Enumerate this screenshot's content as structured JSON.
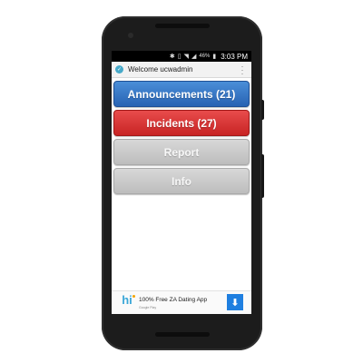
{
  "statusbar": {
    "icons": [
      "bluetooth-icon",
      "vibrate-icon",
      "wifi-icon",
      "signal-icon",
      "battery-icon"
    ],
    "battery_pct": "46%",
    "time": "3:03 PM"
  },
  "appbar": {
    "title": "Welcome ucwadmin"
  },
  "menu": {
    "announcements_label": "Announcements (21)",
    "incidents_label": "Incidents (27)",
    "report_label": "Report",
    "info_label": "Info"
  },
  "ad": {
    "title": "100% Free ZA Dating App",
    "store_label": "Google Play",
    "logo_letters": "hi"
  },
  "colors": {
    "announcements": "#2f6fc0",
    "incidents": "#d63030",
    "disabled": "#c9c9c9",
    "download": "#1f7fe0"
  }
}
